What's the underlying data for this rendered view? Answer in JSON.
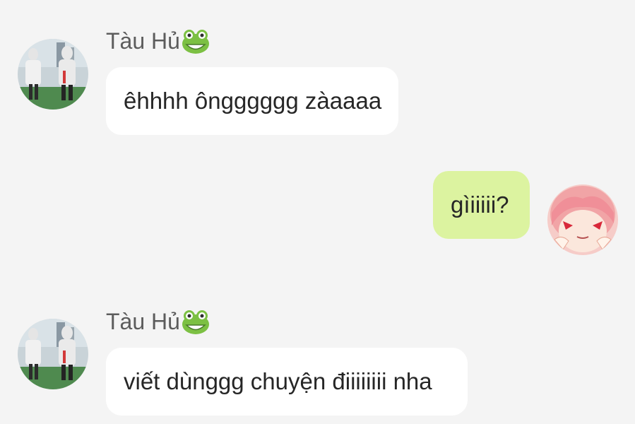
{
  "messages": [
    {
      "direction": "incoming",
      "sender": "Tàu Hủ",
      "sender_emoji": "frog-face",
      "text": "êhhhh ôngggggg zàaaaa"
    },
    {
      "direction": "outgoing",
      "text": "gìiiiii?"
    },
    {
      "direction": "incoming",
      "sender": "Tàu Hủ",
      "sender_emoji": "frog-face",
      "text": "viết dùnggg chuyện điiiiiiii nha"
    }
  ],
  "colors": {
    "background": "#f4f4f4",
    "incoming_bubble": "#ffffff",
    "outgoing_bubble": "#dcf3a0",
    "name_text": "#5c5c5c",
    "message_text": "#262626"
  }
}
